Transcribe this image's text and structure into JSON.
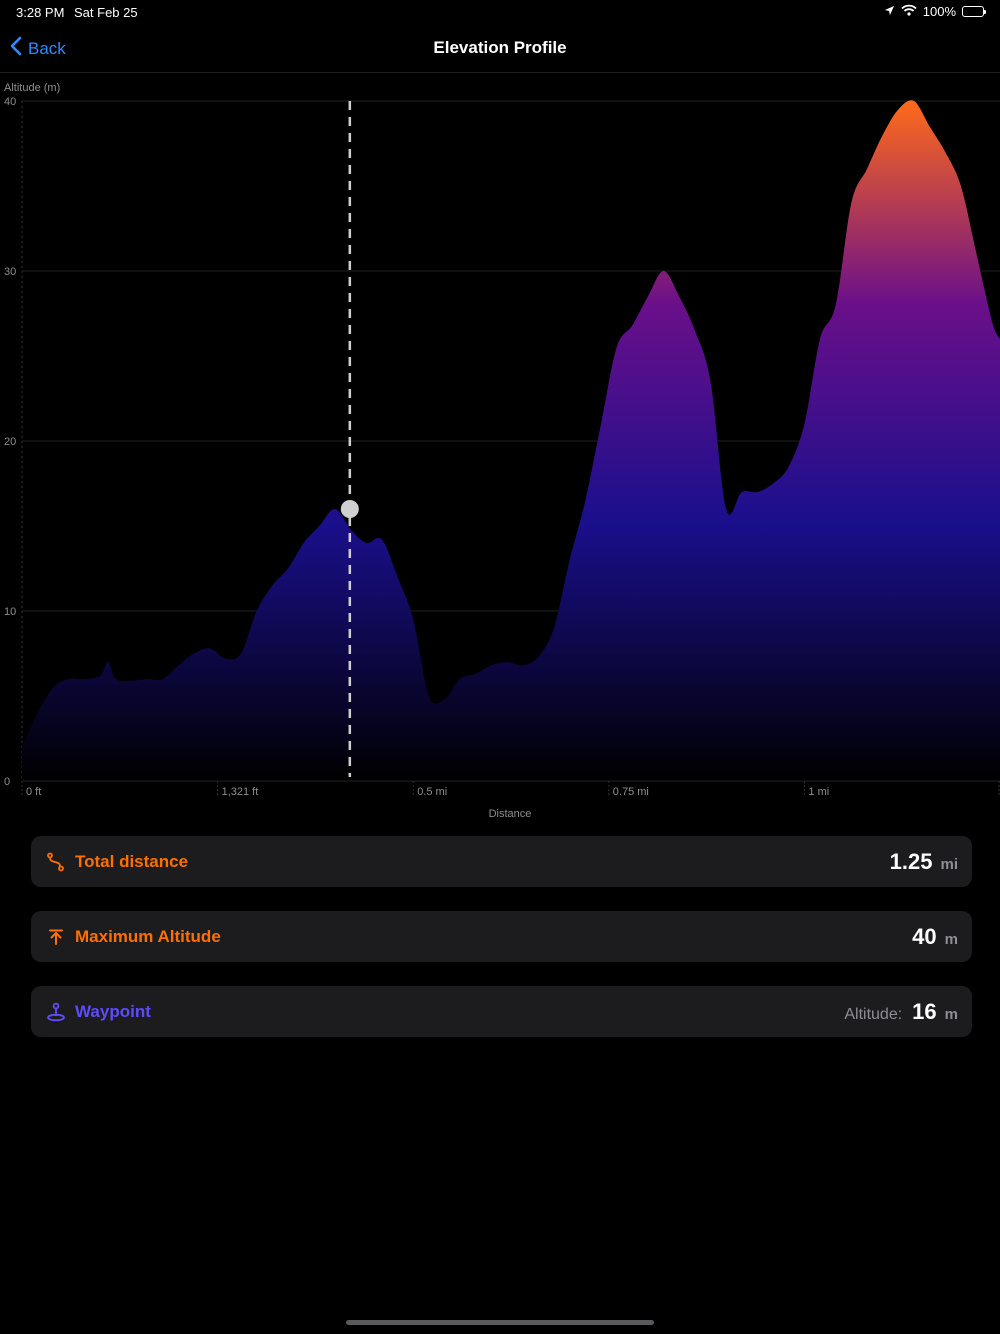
{
  "status_bar": {
    "time": "3:28 PM",
    "date": "Sat Feb 25",
    "battery": "100%"
  },
  "nav": {
    "back_label": "Back",
    "title": "Elevation Profile"
  },
  "chart_data": {
    "type": "area",
    "ylabel": "Altitude (m)",
    "xlabel": "Distance",
    "ylim": [
      0,
      40
    ],
    "y_ticks": [
      "0",
      "10",
      "20",
      "30",
      "40"
    ],
    "x_tick_labels": [
      "0 ft",
      "1,321 ft",
      "0.5 mi",
      "0.75 mi",
      "1 mi"
    ],
    "x_unit": "mi",
    "xlim": [
      0,
      1.25
    ],
    "x_tick_values": [
      0,
      0.25,
      0.5,
      0.75,
      1.0
    ],
    "gradient_colors": [
      "#000000",
      "#1a0f8c",
      "#6a0f8a",
      "#ff6a1a"
    ],
    "selected_point": {
      "x": 0.419,
      "y": 16
    },
    "series": [
      {
        "x": [
          0.0,
          0.02,
          0.04,
          0.06,
          0.08,
          0.1,
          0.11,
          0.12,
          0.14,
          0.16,
          0.18,
          0.2,
          0.22,
          0.24,
          0.26,
          0.28,
          0.3,
          0.32,
          0.34,
          0.36,
          0.38,
          0.4,
          0.42,
          0.44,
          0.46,
          0.48,
          0.5,
          0.52,
          0.54,
          0.56,
          0.58,
          0.6,
          0.62,
          0.64,
          0.66,
          0.68,
          0.7,
          0.72,
          0.74,
          0.76,
          0.78,
          0.8,
          0.82,
          0.84,
          0.86,
          0.88,
          0.9,
          0.92,
          0.94,
          0.96,
          0.98,
          1.0,
          1.02,
          1.04,
          1.06,
          1.08,
          1.1,
          1.12,
          1.14,
          1.16,
          1.18,
          1.2,
          1.22,
          1.24,
          1.25
        ],
        "values": [
          2,
          4,
          5.5,
          6.0,
          6.0,
          6.2,
          7.0,
          6.0,
          5.9,
          6.0,
          6.0,
          6.8,
          7.5,
          7.8,
          7.2,
          7.5,
          10.0,
          11.5,
          12.5,
          14.0,
          15.0,
          16.0,
          14.8,
          14.0,
          14.2,
          12.0,
          9.5,
          5.0,
          4.8,
          6.0,
          6.3,
          6.8,
          7.0,
          6.8,
          7.3,
          9.0,
          13.0,
          16.5,
          21.0,
          25.5,
          26.8,
          28.5,
          30.0,
          28.5,
          26.5,
          23.5,
          16.0,
          17.0,
          17.0,
          17.5,
          18.5,
          21.0,
          26.0,
          28.0,
          34.0,
          36.0,
          38.0,
          39.5,
          40.0,
          38.5,
          37.0,
          35.0,
          31.0,
          27.0,
          26.0
        ]
      }
    ]
  },
  "stats": [
    {
      "label": "Total distance",
      "value": "1.25",
      "unit": "mi",
      "prefix": "",
      "color": "#ff6f00",
      "icon": "route-icon"
    },
    {
      "label": "Maximum Altitude",
      "value": "40",
      "unit": "m",
      "prefix": "",
      "color": "#ff6f00",
      "icon": "arrow-up-to-line-icon"
    },
    {
      "label": "Waypoint",
      "value": "16",
      "unit": "m",
      "prefix": "Altitude:",
      "color": "#5e4bff",
      "icon": "waypoint-pin-icon"
    }
  ]
}
